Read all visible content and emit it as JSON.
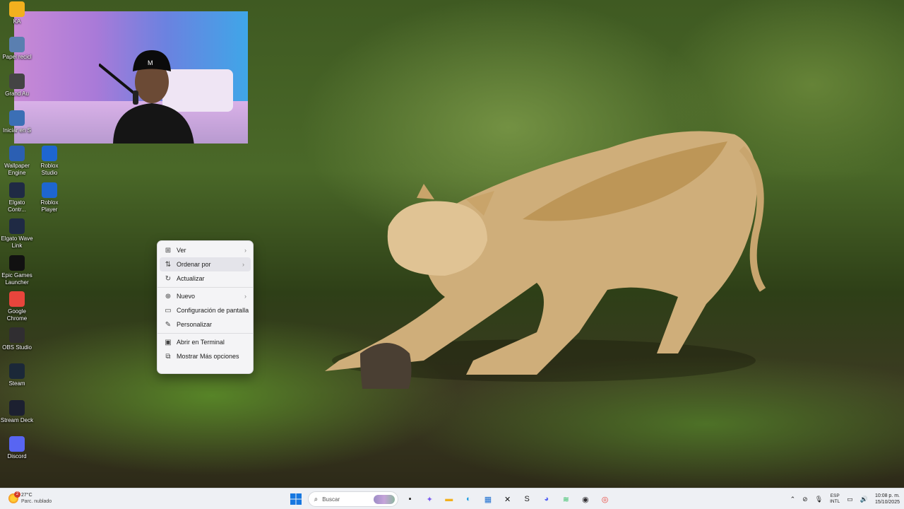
{
  "desktop": {
    "icons": [
      {
        "label": "KA",
        "icon": "folder-icon",
        "color": "#f2b01e"
      },
      {
        "label": "Papel recicl",
        "icon": "recycle-bin-icon",
        "color": "#5a7fb0"
      },
      {
        "label": "Grand Au",
        "icon": "grand-theft-auto-icon",
        "color": "#444"
      },
      {
        "label": "Iniciar en S",
        "icon": "app-icon",
        "color": "#3b6fb5"
      },
      {
        "label": "Wallpaper Engine",
        "icon": "wallpaper-engine-icon",
        "color": "#2b5fb3"
      },
      {
        "label": "Roblox Studio",
        "icon": "roblox-studio-icon",
        "color": "#1e66d0"
      },
      {
        "label": "Elgato Contr...",
        "icon": "elgato-icon",
        "color": "#1f2a44"
      },
      {
        "label": "Roblox Player",
        "icon": "roblox-player-icon",
        "color": "#1e66d0"
      },
      {
        "label": "Elgato Wave Link",
        "icon": "elgato-wave-link-icon",
        "color": "#1f2a44"
      },
      {
        "label": "Epic Games Launcher",
        "icon": "epic-games-icon",
        "color": "#111"
      },
      {
        "label": "Google Chrome",
        "icon": "chrome-icon",
        "color": "#e8453c"
      },
      {
        "label": "OBS Studio",
        "icon": "obs-icon",
        "color": "#302e31"
      },
      {
        "label": "Steam",
        "icon": "steam-icon",
        "color": "#1b2838"
      },
      {
        "label": "Stream Deck",
        "icon": "stream-deck-icon",
        "color": "#1c2030"
      },
      {
        "label": "Discord",
        "icon": "discord-icon",
        "color": "#5865f2"
      }
    ]
  },
  "context_menu": {
    "items": [
      {
        "label": "Ver",
        "icon": "grid-view-icon",
        "glyph": "⊞",
        "submenu": true,
        "hover": false
      },
      {
        "label": "Ordenar por",
        "icon": "sort-icon",
        "glyph": "⇅",
        "submenu": true,
        "hover": true
      },
      {
        "label": "Actualizar",
        "icon": "refresh-icon",
        "glyph": "↻",
        "submenu": false,
        "hover": false
      },
      {
        "label": "Nuevo",
        "icon": "new-icon",
        "glyph": "⊕",
        "submenu": true,
        "hover": false
      },
      {
        "label": "Configuración de pantalla",
        "icon": "display-settings-icon",
        "glyph": "▭",
        "submenu": false,
        "hover": false
      },
      {
        "label": "Personalizar",
        "icon": "personalize-icon",
        "glyph": "✎",
        "submenu": false,
        "hover": false
      },
      {
        "label": "Abrir en Terminal",
        "icon": "terminal-icon",
        "glyph": "▣",
        "submenu": false,
        "hover": false
      },
      {
        "label": "Mostrar Más opciones",
        "icon": "more-options-icon",
        "glyph": "⧉",
        "submenu": false,
        "hover": false
      }
    ]
  },
  "taskbar": {
    "weather": {
      "temp": "27°C",
      "condition": "Parc. nublado",
      "badge": "2"
    },
    "search_placeholder": "Buscar",
    "apps": [
      {
        "name": "task-view-icon",
        "glyph": "▪",
        "color": "#222"
      },
      {
        "name": "copilot-icon",
        "glyph": "✦",
        "color": "#7a5cf0"
      },
      {
        "name": "file-explorer-icon",
        "glyph": "▬",
        "color": "#f2b01e"
      },
      {
        "name": "edge-icon",
        "glyph": "◐",
        "color": "#1a9be0"
      },
      {
        "name": "store-icon",
        "glyph": "▦",
        "color": "#1e6fd0"
      },
      {
        "name": "capcut-icon",
        "glyph": "✕",
        "color": "#111"
      },
      {
        "name": "app-s-icon",
        "glyph": "S",
        "color": "#222"
      },
      {
        "name": "discord-icon",
        "glyph": "◕",
        "color": "#5865f2"
      },
      {
        "name": "spotify-icon",
        "glyph": "≋",
        "color": "#1db954"
      },
      {
        "name": "obs-icon",
        "glyph": "◉",
        "color": "#302e31"
      },
      {
        "name": "chrome-icon",
        "glyph": "◎",
        "color": "#e8453c"
      }
    ],
    "tray": {
      "language_top": "ESP",
      "language_bottom": "INTL",
      "time": "10:08 p. m.",
      "date": "15/10/2025"
    }
  }
}
